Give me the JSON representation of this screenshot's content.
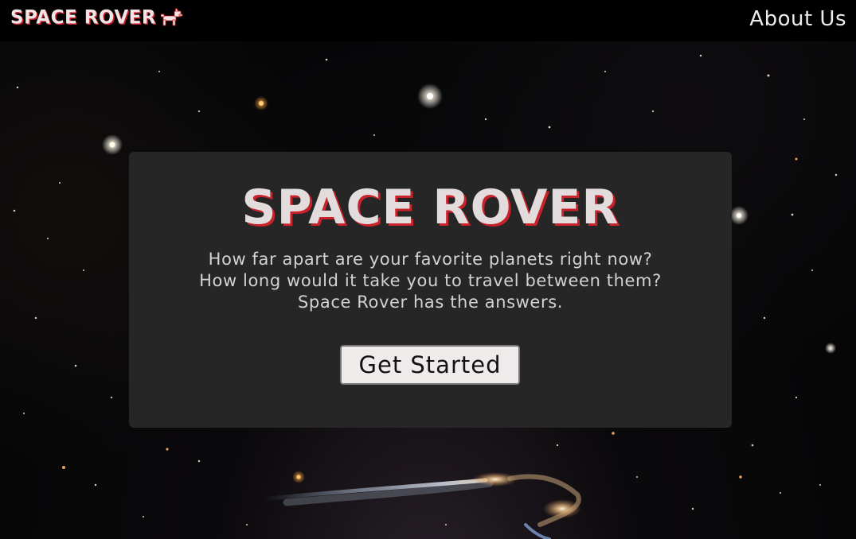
{
  "navbar": {
    "brand_label": "SPACE ROVER",
    "brand_icon": "rover-dog-icon",
    "about_label": "About Us"
  },
  "hero": {
    "title": "SPACE ROVER",
    "description_lines": [
      "How far apart are your favorite planets right now?",
      "How long would it take you to travel between them?",
      "Space Rover has the answers."
    ],
    "cta_label": "Get Started"
  },
  "colors": {
    "navbar_bg": "#000000",
    "card_bg": "#262626",
    "title_text": "#e2dcdc",
    "title_shadow": "#c9222b",
    "button_bg": "#efebeb"
  }
}
